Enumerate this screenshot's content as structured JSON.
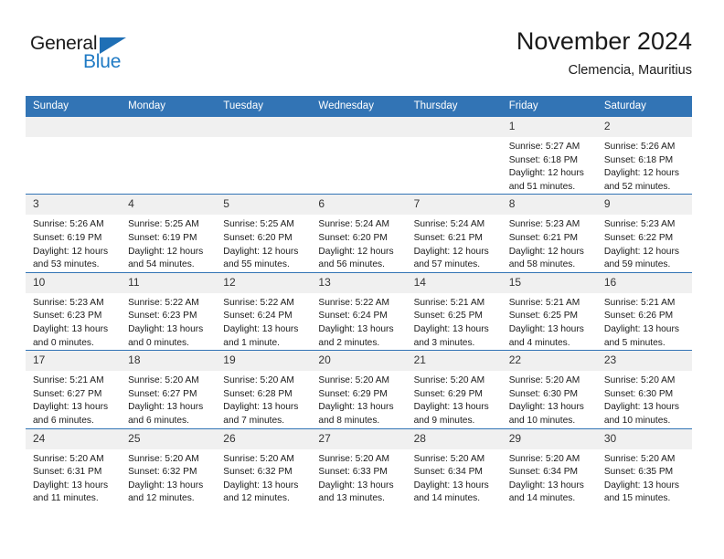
{
  "brand": {
    "name_part1": "General",
    "name_part2": "Blue",
    "triangle_color": "#1f6fb5",
    "blue_text_color": "#1f7ac4"
  },
  "header": {
    "title": "November 2024",
    "subtitle": "Clemencia, Mauritius"
  },
  "theme": {
    "header_bar_color": "#3274b5",
    "daynum_bg": "#f0f0f0",
    "row_border_color": "#3274b5"
  },
  "weekday_headers": [
    "Sunday",
    "Monday",
    "Tuesday",
    "Wednesday",
    "Thursday",
    "Friday",
    "Saturday"
  ],
  "weeks": [
    [
      {
        "day": "",
        "lines": []
      },
      {
        "day": "",
        "lines": []
      },
      {
        "day": "",
        "lines": []
      },
      {
        "day": "",
        "lines": []
      },
      {
        "day": "",
        "lines": []
      },
      {
        "day": "1",
        "lines": [
          "Sunrise: 5:27 AM",
          "Sunset: 6:18 PM",
          "Daylight: 12 hours",
          "and 51 minutes."
        ]
      },
      {
        "day": "2",
        "lines": [
          "Sunrise: 5:26 AM",
          "Sunset: 6:18 PM",
          "Daylight: 12 hours",
          "and 52 minutes."
        ]
      }
    ],
    [
      {
        "day": "3",
        "lines": [
          "Sunrise: 5:26 AM",
          "Sunset: 6:19 PM",
          "Daylight: 12 hours",
          "and 53 minutes."
        ]
      },
      {
        "day": "4",
        "lines": [
          "Sunrise: 5:25 AM",
          "Sunset: 6:19 PM",
          "Daylight: 12 hours",
          "and 54 minutes."
        ]
      },
      {
        "day": "5",
        "lines": [
          "Sunrise: 5:25 AM",
          "Sunset: 6:20 PM",
          "Daylight: 12 hours",
          "and 55 minutes."
        ]
      },
      {
        "day": "6",
        "lines": [
          "Sunrise: 5:24 AM",
          "Sunset: 6:20 PM",
          "Daylight: 12 hours",
          "and 56 minutes."
        ]
      },
      {
        "day": "7",
        "lines": [
          "Sunrise: 5:24 AM",
          "Sunset: 6:21 PM",
          "Daylight: 12 hours",
          "and 57 minutes."
        ]
      },
      {
        "day": "8",
        "lines": [
          "Sunrise: 5:23 AM",
          "Sunset: 6:21 PM",
          "Daylight: 12 hours",
          "and 58 minutes."
        ]
      },
      {
        "day": "9",
        "lines": [
          "Sunrise: 5:23 AM",
          "Sunset: 6:22 PM",
          "Daylight: 12 hours",
          "and 59 minutes."
        ]
      }
    ],
    [
      {
        "day": "10",
        "lines": [
          "Sunrise: 5:23 AM",
          "Sunset: 6:23 PM",
          "Daylight: 13 hours",
          "and 0 minutes."
        ]
      },
      {
        "day": "11",
        "lines": [
          "Sunrise: 5:22 AM",
          "Sunset: 6:23 PM",
          "Daylight: 13 hours",
          "and 0 minutes."
        ]
      },
      {
        "day": "12",
        "lines": [
          "Sunrise: 5:22 AM",
          "Sunset: 6:24 PM",
          "Daylight: 13 hours",
          "and 1 minute."
        ]
      },
      {
        "day": "13",
        "lines": [
          "Sunrise: 5:22 AM",
          "Sunset: 6:24 PM",
          "Daylight: 13 hours",
          "and 2 minutes."
        ]
      },
      {
        "day": "14",
        "lines": [
          "Sunrise: 5:21 AM",
          "Sunset: 6:25 PM",
          "Daylight: 13 hours",
          "and 3 minutes."
        ]
      },
      {
        "day": "15",
        "lines": [
          "Sunrise: 5:21 AM",
          "Sunset: 6:25 PM",
          "Daylight: 13 hours",
          "and 4 minutes."
        ]
      },
      {
        "day": "16",
        "lines": [
          "Sunrise: 5:21 AM",
          "Sunset: 6:26 PM",
          "Daylight: 13 hours",
          "and 5 minutes."
        ]
      }
    ],
    [
      {
        "day": "17",
        "lines": [
          "Sunrise: 5:21 AM",
          "Sunset: 6:27 PM",
          "Daylight: 13 hours",
          "and 6 minutes."
        ]
      },
      {
        "day": "18",
        "lines": [
          "Sunrise: 5:20 AM",
          "Sunset: 6:27 PM",
          "Daylight: 13 hours",
          "and 6 minutes."
        ]
      },
      {
        "day": "19",
        "lines": [
          "Sunrise: 5:20 AM",
          "Sunset: 6:28 PM",
          "Daylight: 13 hours",
          "and 7 minutes."
        ]
      },
      {
        "day": "20",
        "lines": [
          "Sunrise: 5:20 AM",
          "Sunset: 6:29 PM",
          "Daylight: 13 hours",
          "and 8 minutes."
        ]
      },
      {
        "day": "21",
        "lines": [
          "Sunrise: 5:20 AM",
          "Sunset: 6:29 PM",
          "Daylight: 13 hours",
          "and 9 minutes."
        ]
      },
      {
        "day": "22",
        "lines": [
          "Sunrise: 5:20 AM",
          "Sunset: 6:30 PM",
          "Daylight: 13 hours",
          "and 10 minutes."
        ]
      },
      {
        "day": "23",
        "lines": [
          "Sunrise: 5:20 AM",
          "Sunset: 6:30 PM",
          "Daylight: 13 hours",
          "and 10 minutes."
        ]
      }
    ],
    [
      {
        "day": "24",
        "lines": [
          "Sunrise: 5:20 AM",
          "Sunset: 6:31 PM",
          "Daylight: 13 hours",
          "and 11 minutes."
        ]
      },
      {
        "day": "25",
        "lines": [
          "Sunrise: 5:20 AM",
          "Sunset: 6:32 PM",
          "Daylight: 13 hours",
          "and 12 minutes."
        ]
      },
      {
        "day": "26",
        "lines": [
          "Sunrise: 5:20 AM",
          "Sunset: 6:32 PM",
          "Daylight: 13 hours",
          "and 12 minutes."
        ]
      },
      {
        "day": "27",
        "lines": [
          "Sunrise: 5:20 AM",
          "Sunset: 6:33 PM",
          "Daylight: 13 hours",
          "and 13 minutes."
        ]
      },
      {
        "day": "28",
        "lines": [
          "Sunrise: 5:20 AM",
          "Sunset: 6:34 PM",
          "Daylight: 13 hours",
          "and 14 minutes."
        ]
      },
      {
        "day": "29",
        "lines": [
          "Sunrise: 5:20 AM",
          "Sunset: 6:34 PM",
          "Daylight: 13 hours",
          "and 14 minutes."
        ]
      },
      {
        "day": "30",
        "lines": [
          "Sunrise: 5:20 AM",
          "Sunset: 6:35 PM",
          "Daylight: 13 hours",
          "and 15 minutes."
        ]
      }
    ]
  ]
}
